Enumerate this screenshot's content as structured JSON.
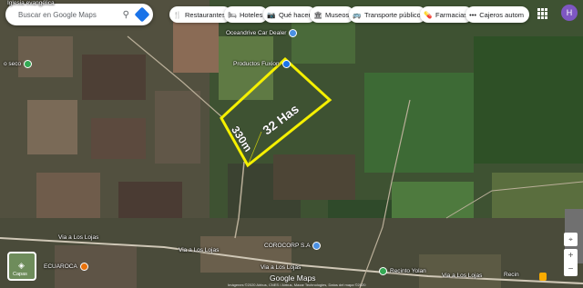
{
  "search": {
    "placeholder": "Buscar en Google Maps"
  },
  "categories": [
    {
      "label": "Restaurantes",
      "icon": "fork-knife-icon"
    },
    {
      "label": "Hoteles",
      "icon": "bed-icon"
    },
    {
      "label": "Qué hacer",
      "icon": "camera-icon"
    },
    {
      "label": "Museos",
      "icon": "museum-icon"
    },
    {
      "label": "Transporte público",
      "icon": "bus-icon"
    },
    {
      "label": "Farmacias",
      "icon": "pharmacy-icon"
    },
    {
      "label": "Cajeros autom",
      "icon": "more-icon"
    }
  ],
  "account": {
    "initial": "H"
  },
  "overlay": {
    "area_label": "32 Has",
    "side_label": "330m",
    "color": "#f5f000"
  },
  "places": [
    {
      "name": "Oceandrive Car Dealer"
    },
    {
      "name": "Productos Fuxion"
    },
    {
      "name": "COROCORP S.A"
    },
    {
      "name": "ECUAROCA"
    },
    {
      "name": "Recinto Yolan"
    },
    {
      "name": "Iglesia evangélica"
    },
    {
      "name": "o seco"
    }
  ],
  "roads": [
    {
      "name": "Via a Los Lojas"
    },
    {
      "name": "Via a Los Lojas"
    },
    {
      "name": "Via a Los Lojas"
    },
    {
      "name": "Via a Los Lojas"
    }
  ],
  "layers": {
    "label": "Capas"
  },
  "branding": {
    "label": "Google Maps"
  },
  "attribution": "Imágenes ©2020 Airbus, CNES / Airbus, Maxar Technologies, Datos del mapa ©2020",
  "scale": {
    "label": "Recin"
  }
}
